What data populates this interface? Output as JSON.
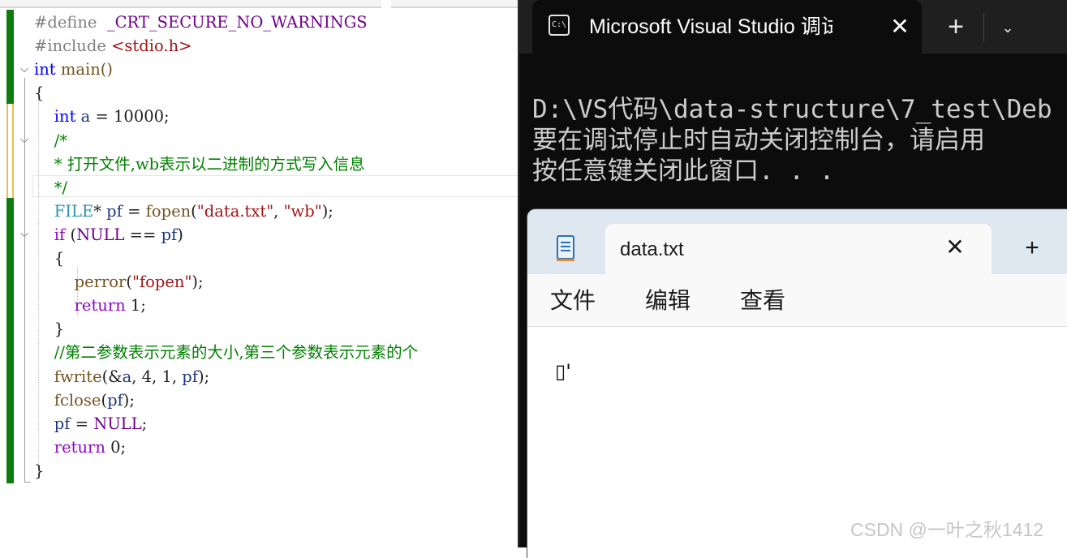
{
  "editor": {
    "lines": [
      [
        {
          "t": "#define  ",
          "c": "c-pre"
        },
        {
          "t": "_CRT_SECURE_NO_WARNINGS",
          "c": "c-mac"
        }
      ],
      [
        {
          "t": "#include ",
          "c": "c-pre"
        },
        {
          "t": "<stdio.h>",
          "c": "c-inc"
        }
      ],
      [
        {
          "t": "int",
          "c": "c-kw"
        },
        {
          "t": " main()",
          "c": "c-fn"
        }
      ],
      [
        {
          "t": "{",
          "c": ""
        }
      ],
      [
        {
          "t": "    ",
          "c": ""
        },
        {
          "t": "int",
          "c": "c-kw"
        },
        {
          "t": " ",
          "c": ""
        },
        {
          "t": "a",
          "c": "c-var"
        },
        {
          "t": " = 10000;",
          "c": ""
        }
      ],
      [
        {
          "t": "    ",
          "c": ""
        },
        {
          "t": "/*",
          "c": "c-cm"
        }
      ],
      [
        {
          "t": "    ",
          "c": ""
        },
        {
          "t": "* 打开文件,wb表示以二进制的方式写入信息",
          "c": "c-cm"
        }
      ],
      [
        {
          "t": "    ",
          "c": ""
        },
        {
          "t": "*/",
          "c": "c-cm"
        }
      ],
      [
        {
          "t": "    ",
          "c": ""
        },
        {
          "t": "FILE",
          "c": "c-type"
        },
        {
          "t": "* ",
          "c": ""
        },
        {
          "t": "pf",
          "c": "c-var"
        },
        {
          "t": " = ",
          "c": ""
        },
        {
          "t": "fopen",
          "c": "c-fn"
        },
        {
          "t": "(",
          "c": ""
        },
        {
          "t": "\"data.txt\"",
          "c": "c-str"
        },
        {
          "t": ", ",
          "c": ""
        },
        {
          "t": "\"wb\"",
          "c": "c-str"
        },
        {
          "t": ");",
          "c": ""
        }
      ],
      [
        {
          "t": "    ",
          "c": ""
        },
        {
          "t": "if",
          "c": "c-ret"
        },
        {
          "t": " (",
          "c": ""
        },
        {
          "t": "NULL",
          "c": "c-mac"
        },
        {
          "t": " == ",
          "c": ""
        },
        {
          "t": "pf",
          "c": "c-var"
        },
        {
          "t": ")",
          "c": ""
        }
      ],
      [
        {
          "t": "    {",
          "c": ""
        }
      ],
      [
        {
          "t": "        ",
          "c": ""
        },
        {
          "t": "perror",
          "c": "c-fn"
        },
        {
          "t": "(",
          "c": ""
        },
        {
          "t": "\"fopen\"",
          "c": "c-str"
        },
        {
          "t": ");",
          "c": ""
        }
      ],
      [
        {
          "t": "        ",
          "c": ""
        },
        {
          "t": "return",
          "c": "c-ret"
        },
        {
          "t": " 1;",
          "c": ""
        }
      ],
      [
        {
          "t": "    }",
          "c": ""
        }
      ],
      [
        {
          "t": "    ",
          "c": ""
        },
        {
          "t": "//第二参数表示元素的大小,第三个参数表示元素的个",
          "c": "c-cm"
        }
      ],
      [
        {
          "t": "    ",
          "c": ""
        },
        {
          "t": "fwrite",
          "c": "c-fn"
        },
        {
          "t": "(&",
          "c": ""
        },
        {
          "t": "a",
          "c": "c-var"
        },
        {
          "t": ", 4, 1, ",
          "c": ""
        },
        {
          "t": "pf",
          "c": "c-var"
        },
        {
          "t": ");",
          "c": ""
        }
      ],
      [
        {
          "t": "    ",
          "c": ""
        },
        {
          "t": "fclose",
          "c": "c-fn"
        },
        {
          "t": "(",
          "c": ""
        },
        {
          "t": "pf",
          "c": "c-var"
        },
        {
          "t": ");",
          "c": ""
        }
      ],
      [
        {
          "t": "    ",
          "c": ""
        },
        {
          "t": "pf",
          "c": "c-var"
        },
        {
          "t": " = ",
          "c": ""
        },
        {
          "t": "NULL",
          "c": "c-mac"
        },
        {
          "t": ";",
          "c": ""
        }
      ],
      [
        {
          "t": "    ",
          "c": ""
        },
        {
          "t": "return",
          "c": "c-ret"
        },
        {
          "t": " 0;",
          "c": ""
        }
      ],
      [
        {
          "t": "}",
          "c": ""
        }
      ]
    ]
  },
  "console": {
    "tab_title": "Microsoft Visual Studio 调试控制台",
    "tab_icon_text": "C:\\",
    "close_glyph": "✕",
    "new_tab_glyph": "+",
    "dropdown_glyph": "⌄",
    "output": [
      "D:\\VS代码\\data-structure\\7_test\\Deb",
      "要在调试停止时自动关闭控制台，请启用",
      "按任意键关闭此窗口. . ."
    ]
  },
  "notepad": {
    "tab_title": "data.txt",
    "close_glyph": "✕",
    "new_tab_glyph": "+",
    "menu": [
      "文件",
      "编辑",
      "查看"
    ],
    "content": "▯'"
  },
  "watermark": "CSDN @一叶之秋1412",
  "colors": {
    "editor_bg": "#ffffff",
    "console_bg": "#0c0c0c",
    "notepad_tabbar": "#dfe7f1",
    "change_bar_green": "#107c10",
    "change_bar_yellow": "#e2c052"
  }
}
